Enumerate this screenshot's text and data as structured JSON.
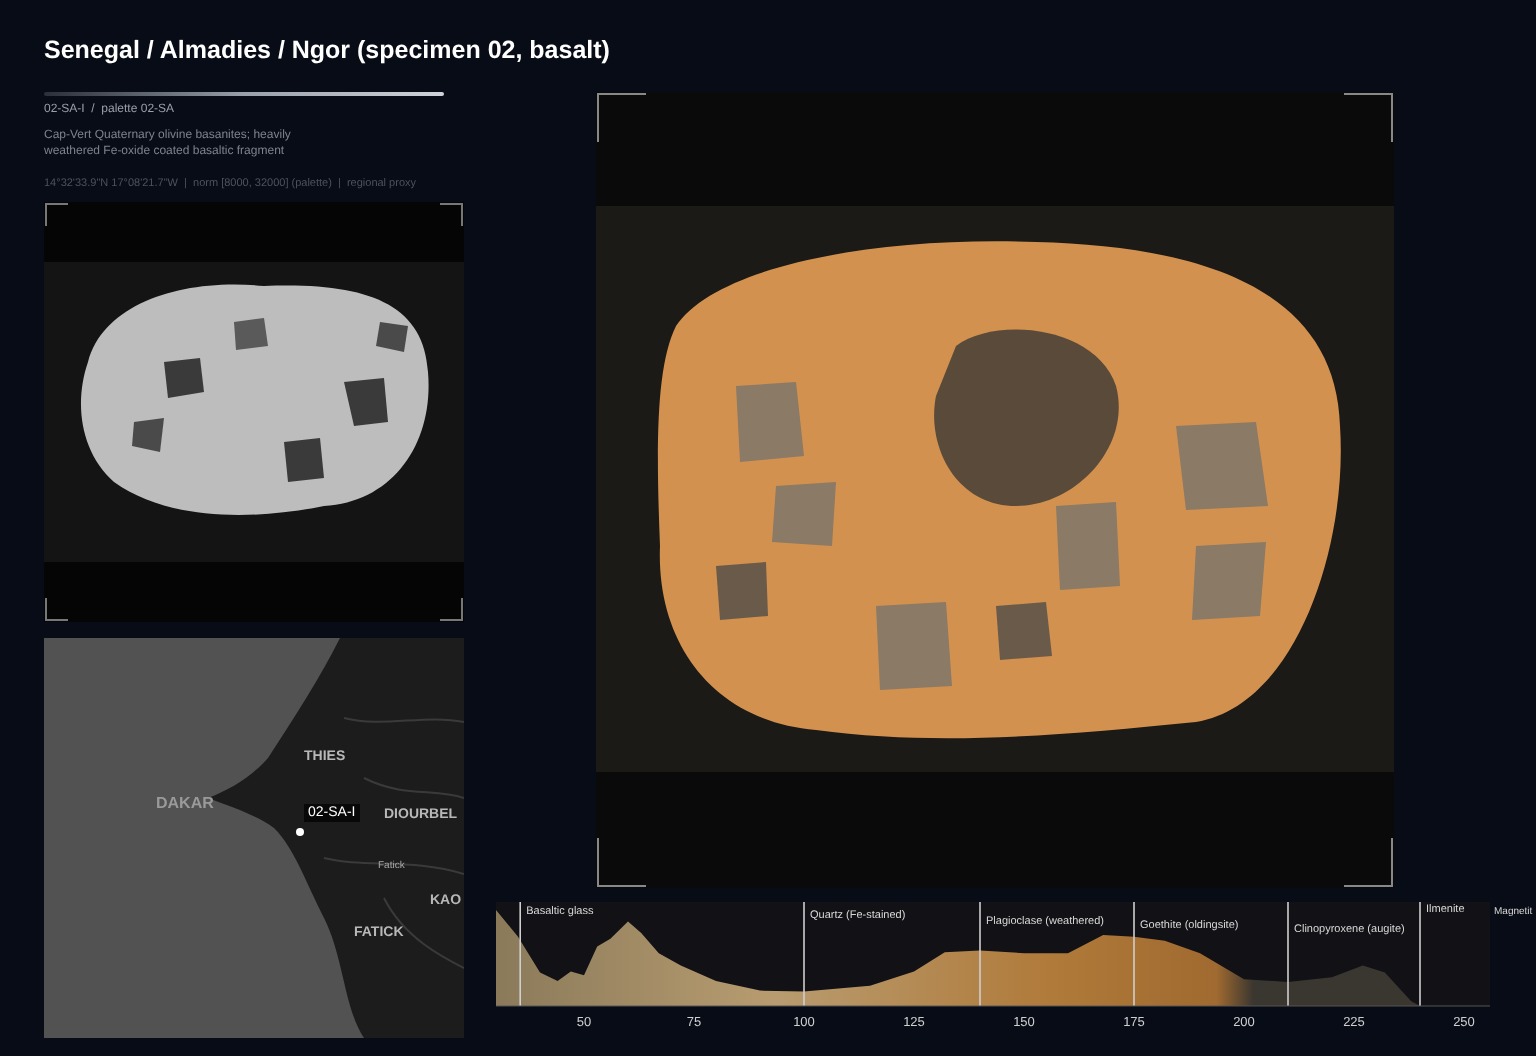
{
  "title": "Senegal / Almadies / Ngor (specimen 02, basalt)",
  "specimen": {
    "code": "02-SA-I  /  palette 02-SA",
    "description": "Cap-Vert Quaternary olivine basanites; heavily weathered Fe-oxide coated basaltic fragment",
    "meta": "14°32'33.9\"N 17°08'21.7\"W  |  norm [8000, 32000] (palette)  |  regional proxy"
  },
  "map": {
    "labels": [
      {
        "text": "DAKAR",
        "kind": "city"
      },
      {
        "text": "THIES",
        "kind": "region"
      },
      {
        "text": "DIOURBEL",
        "kind": "region"
      },
      {
        "text": "Fatick",
        "kind": "town"
      },
      {
        "text": "KAO",
        "kind": "region"
      },
      {
        "text": "FATICK",
        "kind": "region"
      }
    ],
    "marker": {
      "label": "02-SA-I"
    }
  },
  "histogram": {
    "minerals": [
      "Basaltic glass",
      "Quartz (Fe-stained)",
      "Plagioclase (weathered)",
      "Goethite (oldingsite)",
      "Clinopyroxene (augite)",
      "Ilmenite",
      "Magnetit"
    ],
    "axis_ticks": [
      "50",
      "75",
      "100",
      "125",
      "150",
      "175",
      "200",
      "225",
      "250"
    ]
  }
}
